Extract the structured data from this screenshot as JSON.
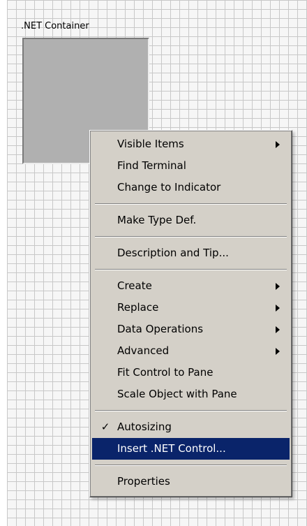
{
  "container": {
    "label": ".NET Container"
  },
  "context_menu": {
    "groups": [
      {
        "items": [
          {
            "label": "Visible Items",
            "submenu": true
          },
          {
            "label": "Find Terminal",
            "submenu": false
          },
          {
            "label": "Change to Indicator",
            "submenu": false
          }
        ]
      },
      {
        "items": [
          {
            "label": "Make Type Def.",
            "submenu": false
          }
        ]
      },
      {
        "items": [
          {
            "label": "Description and Tip...",
            "submenu": false
          }
        ]
      },
      {
        "items": [
          {
            "label": "Create",
            "submenu": true
          },
          {
            "label": "Replace",
            "submenu": true
          },
          {
            "label": "Data Operations",
            "submenu": true
          },
          {
            "label": "Advanced",
            "submenu": true
          },
          {
            "label": "Fit Control to Pane",
            "submenu": false
          },
          {
            "label": "Scale Object with Pane",
            "submenu": false
          }
        ]
      },
      {
        "items": [
          {
            "label": "Autosizing",
            "checked": true,
            "check_glyph": "✓"
          },
          {
            "label": "Insert .NET Control...",
            "highlighted": true
          }
        ]
      },
      {
        "items": [
          {
            "label": "Properties",
            "submenu": false
          }
        ]
      }
    ]
  },
  "colors": {
    "menu_background": "#d4d0c8",
    "highlight": "#0a246a",
    "grid_line": "#c8c8c8",
    "container_fill": "#b0b0b0"
  }
}
